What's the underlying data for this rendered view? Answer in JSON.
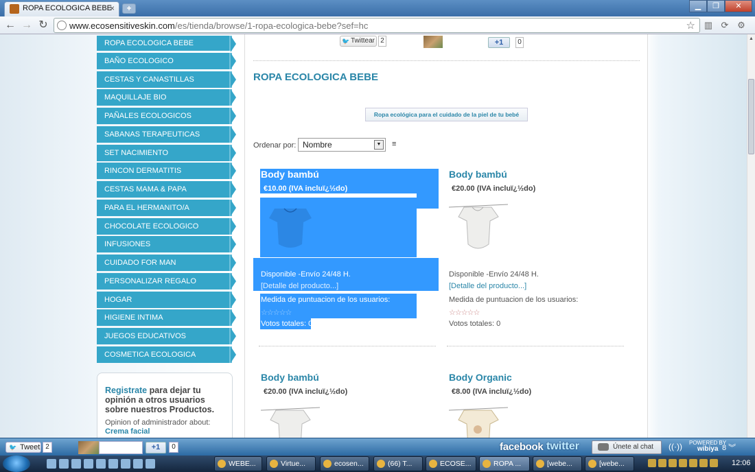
{
  "browser": {
    "tab_title": "ROPA ECOLOGICA BEBE",
    "tab_close": "×",
    "new_tab": "+",
    "window_buttons": [
      "▁",
      "❐",
      "✕"
    ],
    "url_domain": "www.ecosensitiveskin.com",
    "url_path": "/es/tienda/browse/1-ropa-ecologica-bebe?sef=hc",
    "nav": {
      "back": "←",
      "forward": "→",
      "reload": "↻"
    },
    "star": "☆",
    "tools": [
      "▥",
      "⟳",
      "⚙"
    ]
  },
  "sidebar": {
    "items": [
      "ROPA ECOLOGICA BEBE",
      "BAÑO ECOLOGICO",
      "CESTAS Y CANASTILLAS",
      "MAQUILLAJE BIO",
      "PAÑALES ECOLOGICOS",
      "SABANAS TERAPEUTICAS",
      "SET NACIMIENTO",
      "RINCON DERMATITIS",
      "CESTAS MAMA & PAPA",
      "PARA EL HERMANITO/A",
      "CHOCOLATE ECOLOGICO",
      "INFUSIONES",
      "CUIDADO FOR MAN",
      "PERSONALIZAR REGALO",
      "HOGAR",
      "HIGIENE INTIMA",
      "JUEGOS EDUCATIVOS",
      "COSMETICA ECOLOGICA"
    ],
    "register": {
      "link": "Registrate",
      "text": " para dejar tu opinión a otros usuarios sobre nuestros Productos.",
      "note": "Opinion of administrador about:",
      "product_link": "Crema facial"
    }
  },
  "share": {
    "twitter_label": "Twittear",
    "twitter_count": "2",
    "plus_label": "+1",
    "plus_count": "0"
  },
  "main": {
    "category_title": "ROPA ECOLOGICA BEBE",
    "banner": "Ropa ecológica para el cuidado de la piel de tu bebé",
    "sort_label": "Ordenar por:",
    "sort_value": "Nombre",
    "sort_arrow": "▼",
    "sort_direction_icon": "≡"
  },
  "products": [
    {
      "name": "Body bambú",
      "price": "€10.00 (IVA incluï¿½do)",
      "availability": "Disponible -Envío 24/48 H.",
      "detail": "[Detalle del producto...]",
      "rating_label": "Medida de puntuacion de los usuarios:",
      "stars": "☆☆☆☆☆",
      "votes": "Votos totales: 0",
      "selected": true
    },
    {
      "name": "Body bambú",
      "price": "€20.00 (IVA incluï¿½do)",
      "availability": "Disponible -Envío 24/48 H.",
      "detail": "[Detalle del producto...]",
      "rating_label": "Medida de puntuacion de los usuarios:",
      "stars": "☆☆☆☆☆",
      "votes": "Votos totales: 0",
      "selected": false
    },
    {
      "name": "Body bambú",
      "price": "€20.00 (IVA incluï¿½do)",
      "selected": false
    },
    {
      "name": "Body Organic",
      "price": "€8.00 (IVA incluï¿½do)",
      "selected": false
    }
  ],
  "bottombar": {
    "tweet_label": "Tweet",
    "tweet_count": "2",
    "plus_label": "+1",
    "plus_count": "0",
    "facebook": "facebook",
    "twitter": "twitter",
    "chat": "Únete al chat",
    "wibiya_top": "POWERED BY",
    "wibiya_name": "wibiya",
    "controls": "8 ︾"
  },
  "taskbar": {
    "tasks": [
      "WEBE...",
      "Virtue...",
      "ecosen...",
      "(66) T...",
      "ECOSE...",
      "ROPA ...",
      "[webe...",
      "[webe..."
    ],
    "clock": "12:06"
  },
  "colors": {
    "accent": "#35a6c9",
    "link": "#2a86a8",
    "selection": "#3399ff"
  }
}
